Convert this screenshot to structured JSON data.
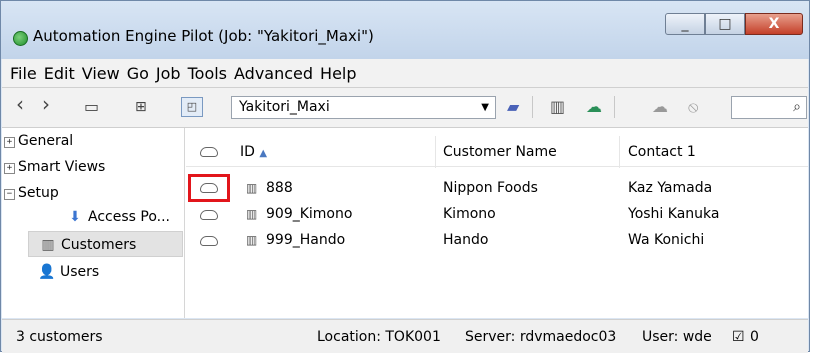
{
  "window": {
    "title": "Automation Engine Pilot (Job: \"Yakitori_Maxi\")",
    "minimize": "_",
    "maximize": "□",
    "close": "X"
  },
  "menu": [
    "File",
    "Edit",
    "View",
    "Go",
    "Job",
    "Tools",
    "Advanced",
    "Help"
  ],
  "toolbar": {
    "back": "‹",
    "forward": "›",
    "job_select_value": "Yakitori_Maxi",
    "search_value": ""
  },
  "sidebar": {
    "general": "General",
    "smart_views": "Smart Views",
    "setup": "Setup",
    "access_point": "Access Po...",
    "customers": "Customers",
    "users": "Users"
  },
  "table": {
    "headers": {
      "id": "ID",
      "customer_name": "Customer Name",
      "contact": "Contact 1"
    },
    "rows": [
      {
        "id": "888",
        "customer_name": "Nippon Foods",
        "contact": "Kaz Yamada"
      },
      {
        "id": "909_Kimono",
        "customer_name": "Kimono",
        "contact": "Yoshi Kanuka"
      },
      {
        "id": "999_Hando",
        "customer_name": "Hando",
        "contact": "Wa Konichi"
      }
    ]
  },
  "status": {
    "count": "3 customers",
    "location": "Location: TOK001",
    "server": "Server: rdvmaedoc03",
    "user": "User: wde",
    "tasks": "0"
  },
  "colors": {
    "highlight": "#e2151b",
    "titlebar": "#c9d9ee",
    "close_button": "#c4402a"
  },
  "icons": [
    "app-icon",
    "back-icon",
    "forward-icon",
    "monitor-icon",
    "grid-icon",
    "panel-icon",
    "new-job-icon",
    "customers-toolbar-icon",
    "sync-icon",
    "cloud-icon",
    "cancel-icon",
    "search-icon",
    "cloud-status-icon",
    "customer-icon",
    "user-icon",
    "access-point-icon"
  ]
}
